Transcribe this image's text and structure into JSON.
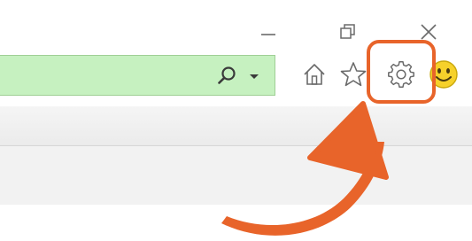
{
  "window_controls": {
    "minimize_icon": "minimize-icon",
    "restore_icon": "restore-icon",
    "close_icon": "close-icon"
  },
  "address_bar": {
    "value": "",
    "placeholder": "",
    "search_icon": "search-icon",
    "dropdown_icon": "chevron-down-icon",
    "background_color": "#c6f1c0"
  },
  "toolbar": {
    "icons": [
      "home-icon",
      "favorites-star-icon",
      "settings-gear-icon",
      "smiley-feedback-icon"
    ]
  },
  "annotation": {
    "highlight_target": "settings-gear-icon",
    "highlight_color": "#e8642a",
    "arrow_color": "#e8642a"
  },
  "colors": {
    "icon_gray": "#6a6a6a",
    "smiley_yellow": "#f6d12b",
    "command_band": "#ececec"
  }
}
